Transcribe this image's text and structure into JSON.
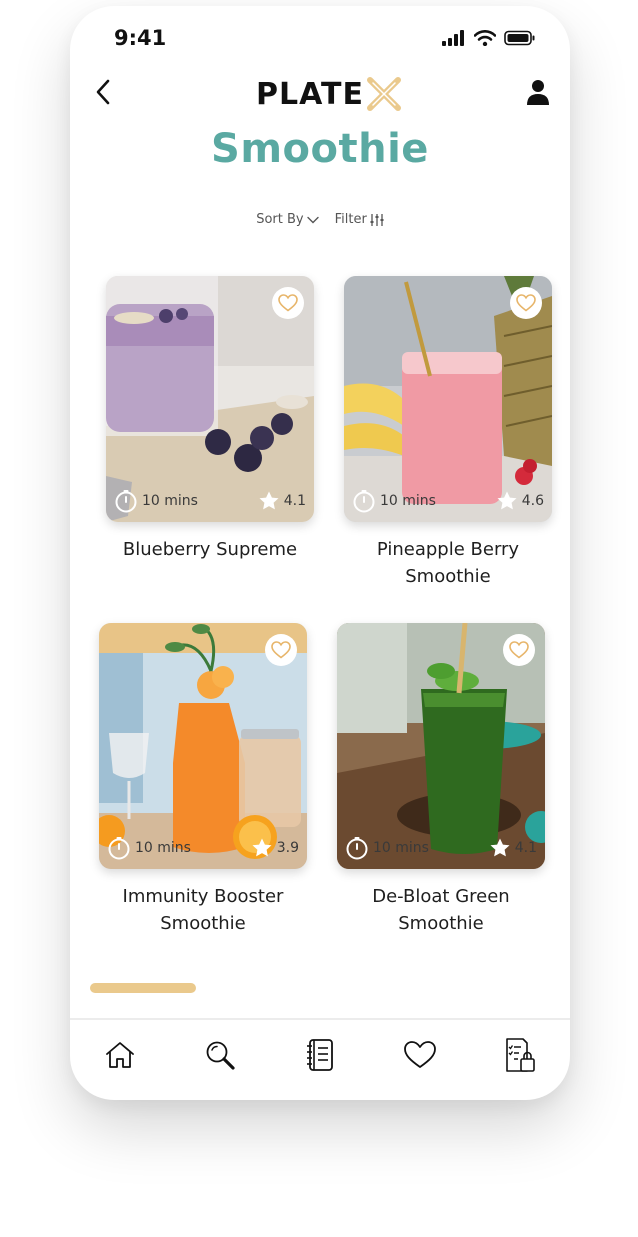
{
  "status_bar": {
    "time": "9:41"
  },
  "header": {
    "logo_text": "PLATE",
    "brand_color": "#eac98c"
  },
  "page": {
    "title": "Smoothie",
    "title_color": "#5aa9a2"
  },
  "controls": {
    "sort_label": "Sort By",
    "filter_label": "Filter"
  },
  "recipes": [
    {
      "name": "Blueberry Supreme",
      "time": "10 mins",
      "rating": "4.1"
    },
    {
      "name": "Pineapple Berry Smoothie",
      "time": "10 mins",
      "rating": "4.6"
    },
    {
      "name": "Immunity Booster Smoothie",
      "time": "10 mins",
      "rating": "3.9"
    },
    {
      "name": "De-Bloat Green Smoothie",
      "time": "10 mins",
      "rating": "4.1"
    }
  ],
  "tabs": [
    {
      "icon": "home-icon"
    },
    {
      "icon": "search-icon"
    },
    {
      "icon": "recipe-book-icon"
    },
    {
      "icon": "heart-icon"
    },
    {
      "icon": "shopping-list-icon"
    }
  ]
}
